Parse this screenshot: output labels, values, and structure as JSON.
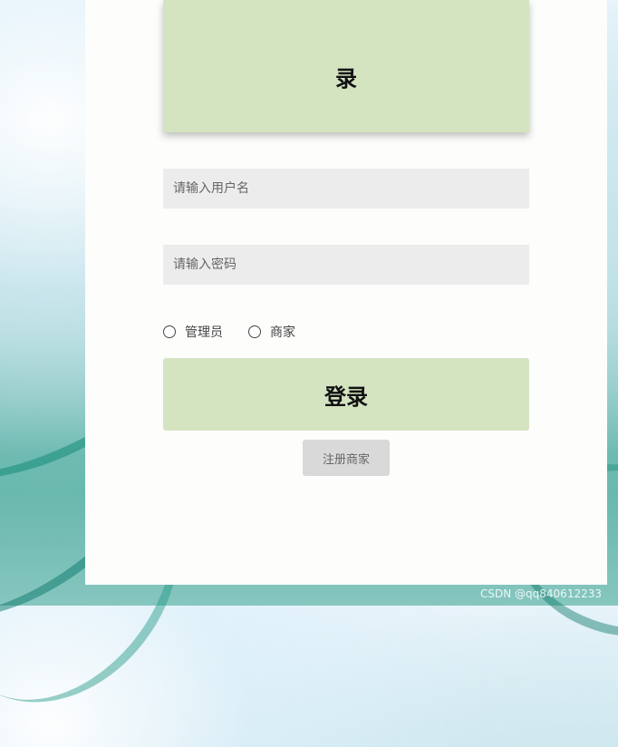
{
  "header": {
    "title": "录"
  },
  "form": {
    "username_placeholder": "请输入用户名",
    "password_placeholder": "请输入密码",
    "roles": [
      {
        "label": "管理员",
        "selected": false
      },
      {
        "label": "商家",
        "selected": false
      }
    ],
    "login_label": "登录",
    "register_label": "注册商家"
  },
  "watermark": "CSDN @qq840612233",
  "colors": {
    "accent": "#d4e4c1",
    "input_bg": "#ececec",
    "panel_bg": "#fdfdfc",
    "secondary_button": "#d9d9d9"
  }
}
